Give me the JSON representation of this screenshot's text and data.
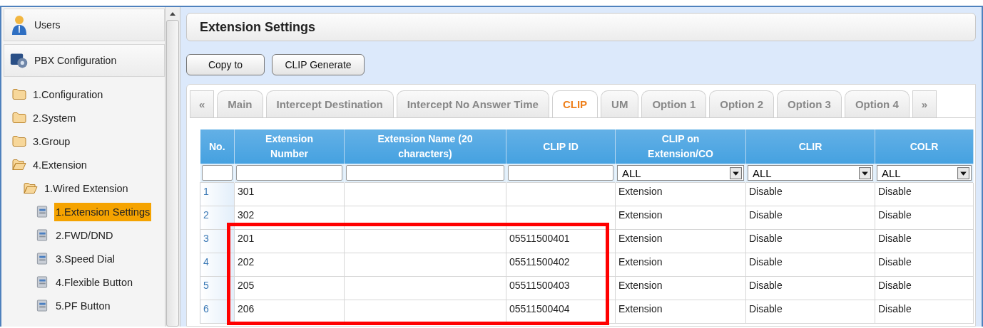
{
  "sidebar": {
    "sections": [
      {
        "label": "Users",
        "kind": "users"
      },
      {
        "label": "PBX Configuration",
        "kind": "pbx"
      }
    ],
    "tree": [
      {
        "label": "1.Configuration",
        "kind": "folder",
        "expanded": false,
        "selected": false
      },
      {
        "label": "2.System",
        "kind": "folder",
        "expanded": false,
        "selected": false
      },
      {
        "label": "3.Group",
        "kind": "folder",
        "expanded": false,
        "selected": false
      },
      {
        "label": "4.Extension",
        "kind": "folder",
        "expanded": true,
        "selected": false,
        "children": [
          {
            "label": "1.Wired Extension",
            "kind": "folder",
            "expanded": true,
            "selected": false,
            "children": [
              {
                "label": "1.Extension Settings",
                "kind": "page",
                "selected": true
              },
              {
                "label": "2.FWD/DND",
                "kind": "page",
                "selected": false
              },
              {
                "label": "3.Speed Dial",
                "kind": "page",
                "selected": false
              },
              {
                "label": "4.Flexible Button",
                "kind": "page",
                "selected": false
              },
              {
                "label": "5.PF Button",
                "kind": "page",
                "selected": false
              }
            ]
          }
        ]
      }
    ]
  },
  "page_title": "Extension Settings",
  "buttons": [
    "Copy to",
    "CLIP Generate"
  ],
  "tabs": [
    {
      "label": "«",
      "kind": "nav",
      "selected": false
    },
    {
      "label": "Main",
      "kind": "tab",
      "selected": false
    },
    {
      "label": "Intercept Destination",
      "kind": "tab",
      "selected": false
    },
    {
      "label": "Intercept No Answer Time",
      "kind": "tab",
      "selected": false
    },
    {
      "label": "CLIP",
      "kind": "tab",
      "selected": true
    },
    {
      "label": "UM",
      "kind": "tab",
      "selected": false
    },
    {
      "label": "Option 1",
      "kind": "tab",
      "selected": false
    },
    {
      "label": "Option 2",
      "kind": "tab",
      "selected": false
    },
    {
      "label": "Option 3",
      "kind": "tab",
      "selected": false
    },
    {
      "label": "Option 4",
      "kind": "tab",
      "selected": false
    },
    {
      "label": "»",
      "kind": "nav",
      "selected": false
    }
  ],
  "table": {
    "columns": [
      {
        "label": "No."
      },
      {
        "label": "Extension Number"
      },
      {
        "label": "Extension Name (20 characters)"
      },
      {
        "label": "CLIP ID"
      },
      {
        "label": "CLIP on Extension/CO",
        "filter_value": "ALL"
      },
      {
        "label": "CLIR",
        "filter_value": "ALL"
      },
      {
        "label": "COLR",
        "filter_value": "ALL"
      }
    ],
    "rows": [
      {
        "cells": [
          "1",
          "301",
          "",
          "",
          "Extension",
          "Disable",
          "Disable"
        ],
        "highlighted": false
      },
      {
        "cells": [
          "2",
          "302",
          "",
          "",
          "Extension",
          "Disable",
          "Disable"
        ],
        "highlighted": false
      },
      {
        "cells": [
          "3",
          "201",
          "",
          "05511500401",
          "Extension",
          "Disable",
          "Disable"
        ],
        "highlighted": true
      },
      {
        "cells": [
          "4",
          "202",
          "",
          "05511500402",
          "Extension",
          "Disable",
          "Disable"
        ],
        "highlighted": true
      },
      {
        "cells": [
          "5",
          "205",
          "",
          "05511500403",
          "Extension",
          "Disable",
          "Disable"
        ],
        "highlighted": true
      },
      {
        "cells": [
          "6",
          "206",
          "",
          "05511500404",
          "Extension",
          "Disable",
          "Disable"
        ],
        "highlighted": true
      }
    ]
  }
}
